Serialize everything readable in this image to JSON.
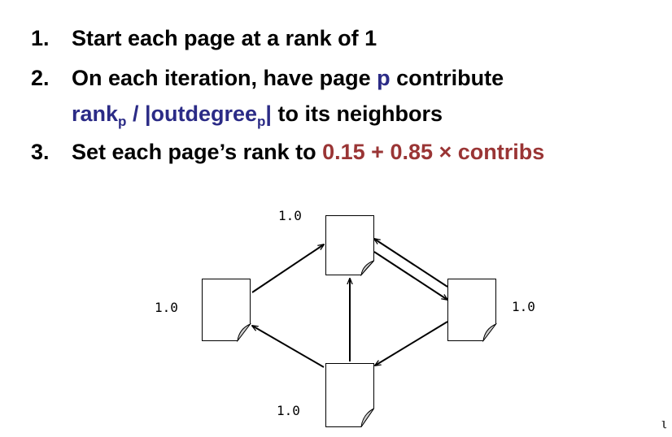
{
  "steps": [
    {
      "number": "1.",
      "text": "Start each page at a rank of 1"
    },
    {
      "number": "2.",
      "text_before": "On each iteration, have page ",
      "highlight_p": "p",
      "text_after": " contribute",
      "formula_rank": "rank",
      "formula_sub1": "p",
      "formula_mid": " / |outdegree",
      "formula_sub2": "p",
      "formula_end": "|",
      "formula_tail": " to its neighbors"
    },
    {
      "number": "3.",
      "text_before": "Set each page’s rank to ",
      "highlight_formula": "0.15 + 0.85 × contribs"
    }
  ],
  "colors": {
    "blue_highlight": "#2b2b86",
    "red_highlight": "#9a3535"
  },
  "nodes": [
    {
      "name": "top",
      "rank": "1.0"
    },
    {
      "name": "left",
      "rank": "1.0"
    },
    {
      "name": "right",
      "rank": "1.0"
    },
    {
      "name": "bottom",
      "rank": "1.0"
    }
  ],
  "edges": [
    {
      "from": "left",
      "to": "top"
    },
    {
      "from": "top",
      "to": "right"
    },
    {
      "from": "right",
      "to": "top"
    },
    {
      "from": "bottom",
      "to": "top"
    },
    {
      "from": "bottom",
      "to": "left"
    },
    {
      "from": "right",
      "to": "bottom"
    }
  ],
  "node_icon": "document-icon",
  "corner_glyph": "ι"
}
